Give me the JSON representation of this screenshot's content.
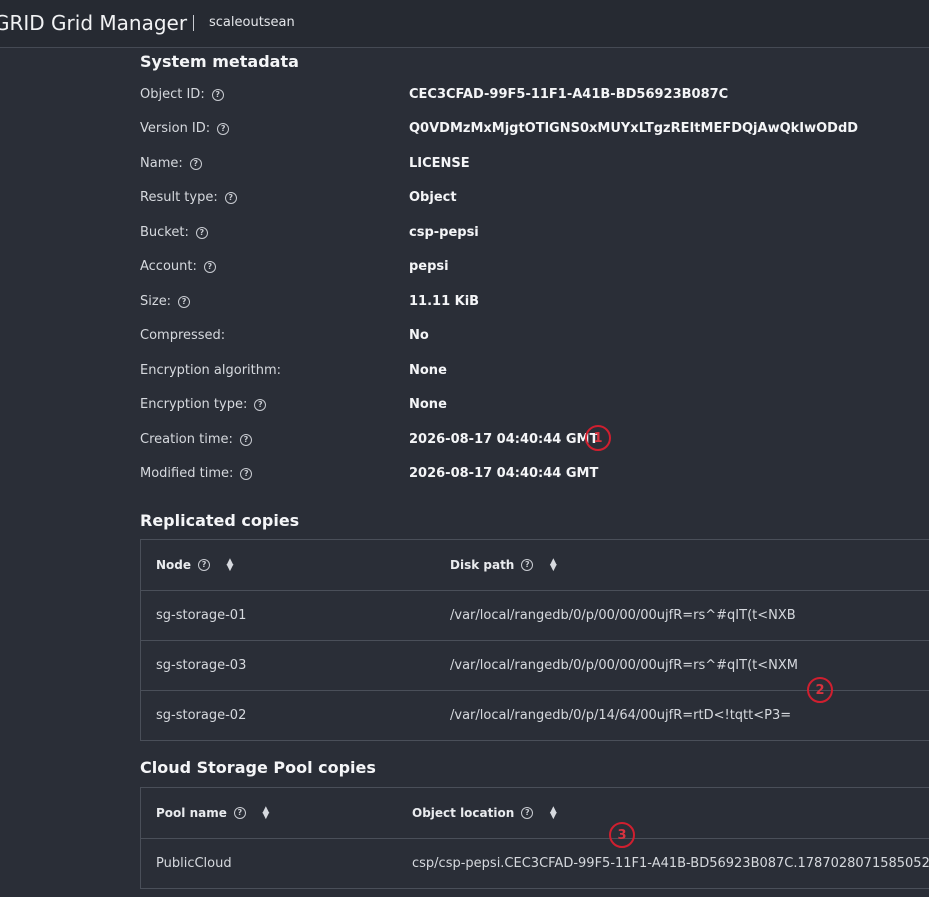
{
  "header": {
    "app_title": "GRID Grid Manager",
    "tenant": "scaleoutsean"
  },
  "system_metadata": {
    "title": "System metadata",
    "rows": [
      {
        "label": "Object ID:",
        "value": "CEC3CFAD-99F5-11F1-A41B-BD56923B087C",
        "help": true
      },
      {
        "label": "Version ID:",
        "value": "Q0VDMzMxMjgtOTlGNS0xMUYxLTgzREItMEFDQjAwQkIwODdD",
        "help": true
      },
      {
        "label": "Name:",
        "value": "LICENSE",
        "help": true
      },
      {
        "label": "Result type:",
        "value": "Object",
        "help": true
      },
      {
        "label": "Bucket:",
        "value": "csp-pepsi",
        "help": true
      },
      {
        "label": "Account:",
        "value": "pepsi",
        "help": true
      },
      {
        "label": "Size:",
        "value": "11.11 KiB",
        "help": true
      },
      {
        "label": "Compressed:",
        "value": "No",
        "help": false
      },
      {
        "label": "Encryption algorithm:",
        "value": "None",
        "help": false
      },
      {
        "label": "Encryption type:",
        "value": "None",
        "help": true
      },
      {
        "label": "Creation time:",
        "value": "2026-08-17 04:40:44 GMT",
        "help": true
      },
      {
        "label": "Modified time:",
        "value": "2026-08-17 04:40:44 GMT",
        "help": true
      }
    ]
  },
  "replicated_copies": {
    "title": "Replicated copies",
    "columns": [
      "Node",
      "Disk path"
    ],
    "rows": [
      [
        "sg-storage-01",
        "/var/local/rangedb/0/p/00/00/00ujfR=rs^#qIT(t<NXB"
      ],
      [
        "sg-storage-03",
        "/var/local/rangedb/0/p/00/00/00ujfR=rs^#qIT(t<NXM"
      ],
      [
        "sg-storage-02",
        "/var/local/rangedb/0/p/14/64/00ujfR=rtD<!tqtt<P3="
      ]
    ]
  },
  "cloud_pool_copies": {
    "title": "Cloud Storage Pool copies",
    "columns": [
      "Pool name",
      "Object location"
    ],
    "rows": [
      [
        "PublicCloud",
        "csp/csp-pepsi.CEC3CFAD-99F5-11F1-A41B-BD56923B087C.1787028071585052"
      ]
    ]
  },
  "markers": [
    "1",
    "2",
    "3"
  ],
  "icons": {
    "help": "?",
    "sort": "sort-icon"
  },
  "colors": {
    "background": "#2a2e37",
    "marker": "#d01f2f"
  }
}
